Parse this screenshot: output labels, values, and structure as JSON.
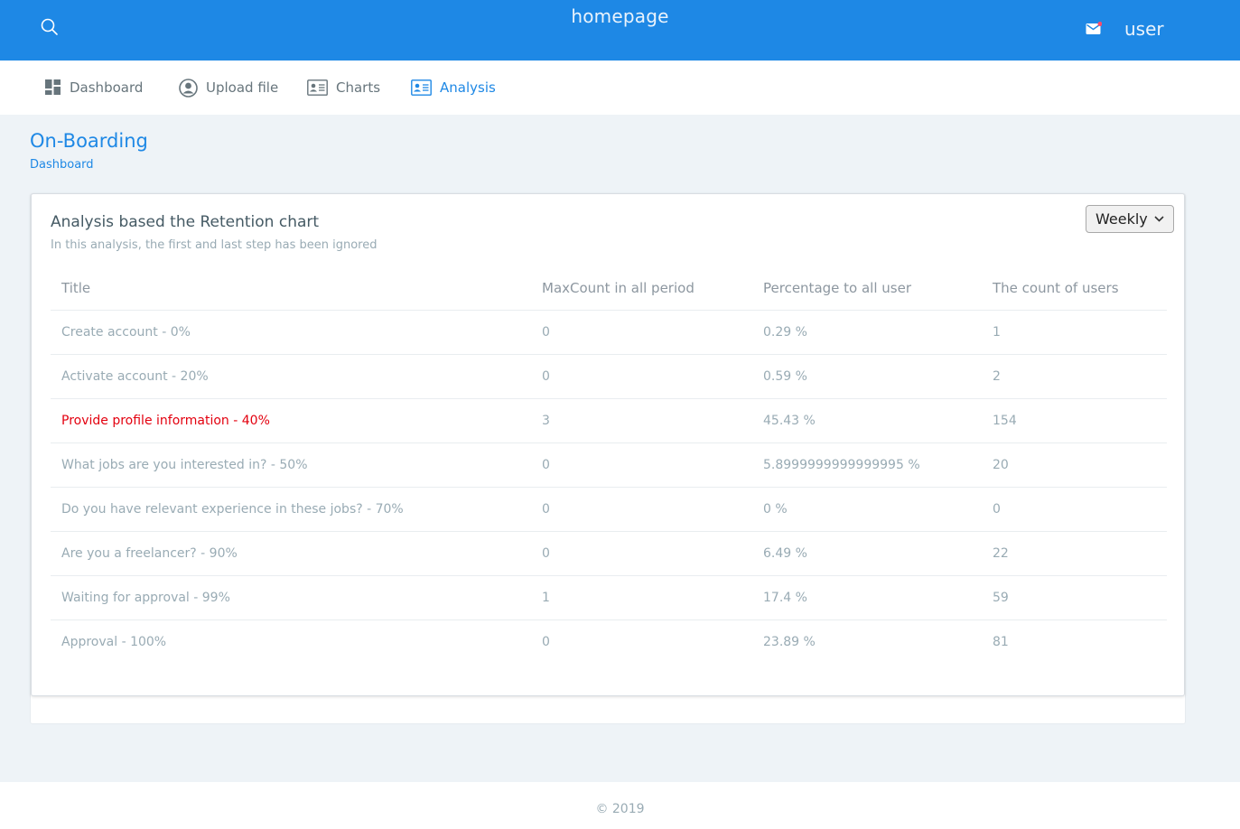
{
  "header": {
    "title": "homepage",
    "user_label": "user"
  },
  "nav": {
    "items": [
      {
        "label": "Dashboard",
        "icon": "dashboard-icon"
      },
      {
        "label": "Upload file",
        "icon": "account-circle-icon"
      },
      {
        "label": "Charts",
        "icon": "id-card-icon"
      },
      {
        "label": "Analysis",
        "icon": "id-card-icon",
        "active": true
      }
    ]
  },
  "page": {
    "title": "On-Boarding",
    "breadcrumb": "Dashboard"
  },
  "card": {
    "title": "Analysis based the Retention chart",
    "subtitle": "In this analysis, the first and last step has been ignored",
    "period_select": "Weekly",
    "table": {
      "headers": [
        "Title",
        "MaxCount in all period",
        "Percentage to all user",
        "The count of users"
      ],
      "rows": [
        [
          "Create account - 0%",
          "0",
          "0.29 %",
          "1"
        ],
        [
          "Activate account - 20%",
          "0",
          "0.59 %",
          "2"
        ],
        [
          "Provide profile information - 40%",
          "3",
          "45.43 %",
          "154"
        ],
        [
          "What jobs are you interested in? - 50%",
          "0",
          "5.8999999999999995 %",
          "20"
        ],
        [
          "Do you have relevant experience in these jobs? - 70%",
          "0",
          "0 %",
          "0"
        ],
        [
          "Are you a freelancer? - 90%",
          "0",
          "6.49 %",
          "22"
        ],
        [
          "Waiting for approval - 99%",
          "1",
          "17.4 %",
          "59"
        ],
        [
          "Approval - 100%",
          "0",
          "23.89 %",
          "81"
        ]
      ],
      "highlighted_row": 2
    }
  },
  "footer": {
    "text": "© 2019"
  },
  "colors": {
    "brand": "#1e88e5",
    "highlight": "#e3000f",
    "notification_dot": "#fc4b6c"
  }
}
